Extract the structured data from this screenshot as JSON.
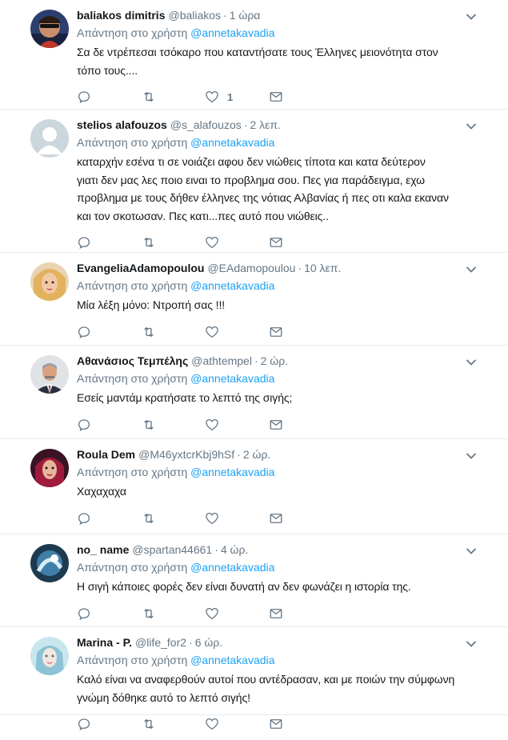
{
  "tweets": [
    {
      "fullname": "baliakos dimitris",
      "username": "@baliakos",
      "time": "1 ώρα",
      "reply_label": "Απάντηση στο χρήστη",
      "reply_mention": "@annetakavadia",
      "text_lines": [
        "Σα δε ντρέπεσαι τσόκαρο που καταντήσατε τους Έλληνες μειονότητα στον",
        "τόπο τους...."
      ],
      "like_count": "1"
    },
    {
      "fullname": "stelios alafouzos",
      "username": "@s_alafouzos",
      "time": "2 λεπ.",
      "reply_label": "Απάντηση στο χρήστη",
      "reply_mention": "@annetakavadia",
      "text_lines": [
        "καταρχήν εσένα τι σε νοιάζει αφου δεν νιώθεις τίποτα  και κατα δεύτερον",
        "γιατι δεν μας λες  ποιο ειναι το προβλημα σου. Πες για παράδειγμα, εχω",
        "προβλημα με τους δήθεν έλληνες της νότιας Αλβανίας ή πες οτι καλα εκαναν",
        "και τον σκοτωσαν. Πες κατι...πες αυτό που νιώθεις.."
      ],
      "like_count": ""
    },
    {
      "fullname": "EvangeliaAdamopoulou",
      "username": "@EAdamopoulou",
      "time": "10 λεπ.",
      "reply_label": "Απάντηση στο χρήστη",
      "reply_mention": "@annetakavadia",
      "text_lines": [
        "Μία λέξη μόνο: Ντροπή σας !!!"
      ],
      "like_count": ""
    },
    {
      "fullname": "Αθανάσιος Τεμπέλης",
      "username": "@athtempel",
      "time": "2 ώρ.",
      "reply_label": "Απάντηση στο χρήστη",
      "reply_mention": "@annetakavadia",
      "text_lines": [
        "Εσείς μαντάμ κρατήσατε το λεπτό της σιγής;"
      ],
      "like_count": ""
    },
    {
      "fullname": "Roula Dem",
      "username": "@M46yxtcrKbj9hSf",
      "time": "2 ώρ.",
      "reply_label": "Απάντηση στο χρήστη",
      "reply_mention": "@annetakavadia",
      "text_lines": [
        "Χαχαχαχα"
      ],
      "like_count": ""
    },
    {
      "fullname": "no_ name",
      "username": "@spartan44661",
      "time": "4 ώρ.",
      "reply_label": "Απάντηση στο χρήστη",
      "reply_mention": "@annetakavadia",
      "text_lines": [
        "Η σιγή κάποιες φορές δεν είναι δυνατή αν δεν φωνάζει η ιστορία της."
      ],
      "like_count": ""
    },
    {
      "fullname": "Marina - P.",
      "username": "@life_for2",
      "time": "6 ώρ.",
      "reply_label": "Απάντηση στο χρήστη",
      "reply_mention": "@annetakavadia",
      "text_lines": [
        "Καλό είναι να αναφερθούν αυτοί που αντέδρασαν, και με ποιών την σύμφωνη",
        "γνώμη δόθηκε αυτό το λεπτό σιγής!"
      ],
      "like_count": ""
    }
  ],
  "icons": {
    "reply": "reply-icon",
    "retweet": "retweet-icon",
    "like": "like-icon",
    "message": "direct-message-icon",
    "caret": "chevron-down-icon"
  },
  "colors": {
    "link": "#1da1f2",
    "secondary_text": "#657786",
    "border": "#e6ecf0"
  }
}
